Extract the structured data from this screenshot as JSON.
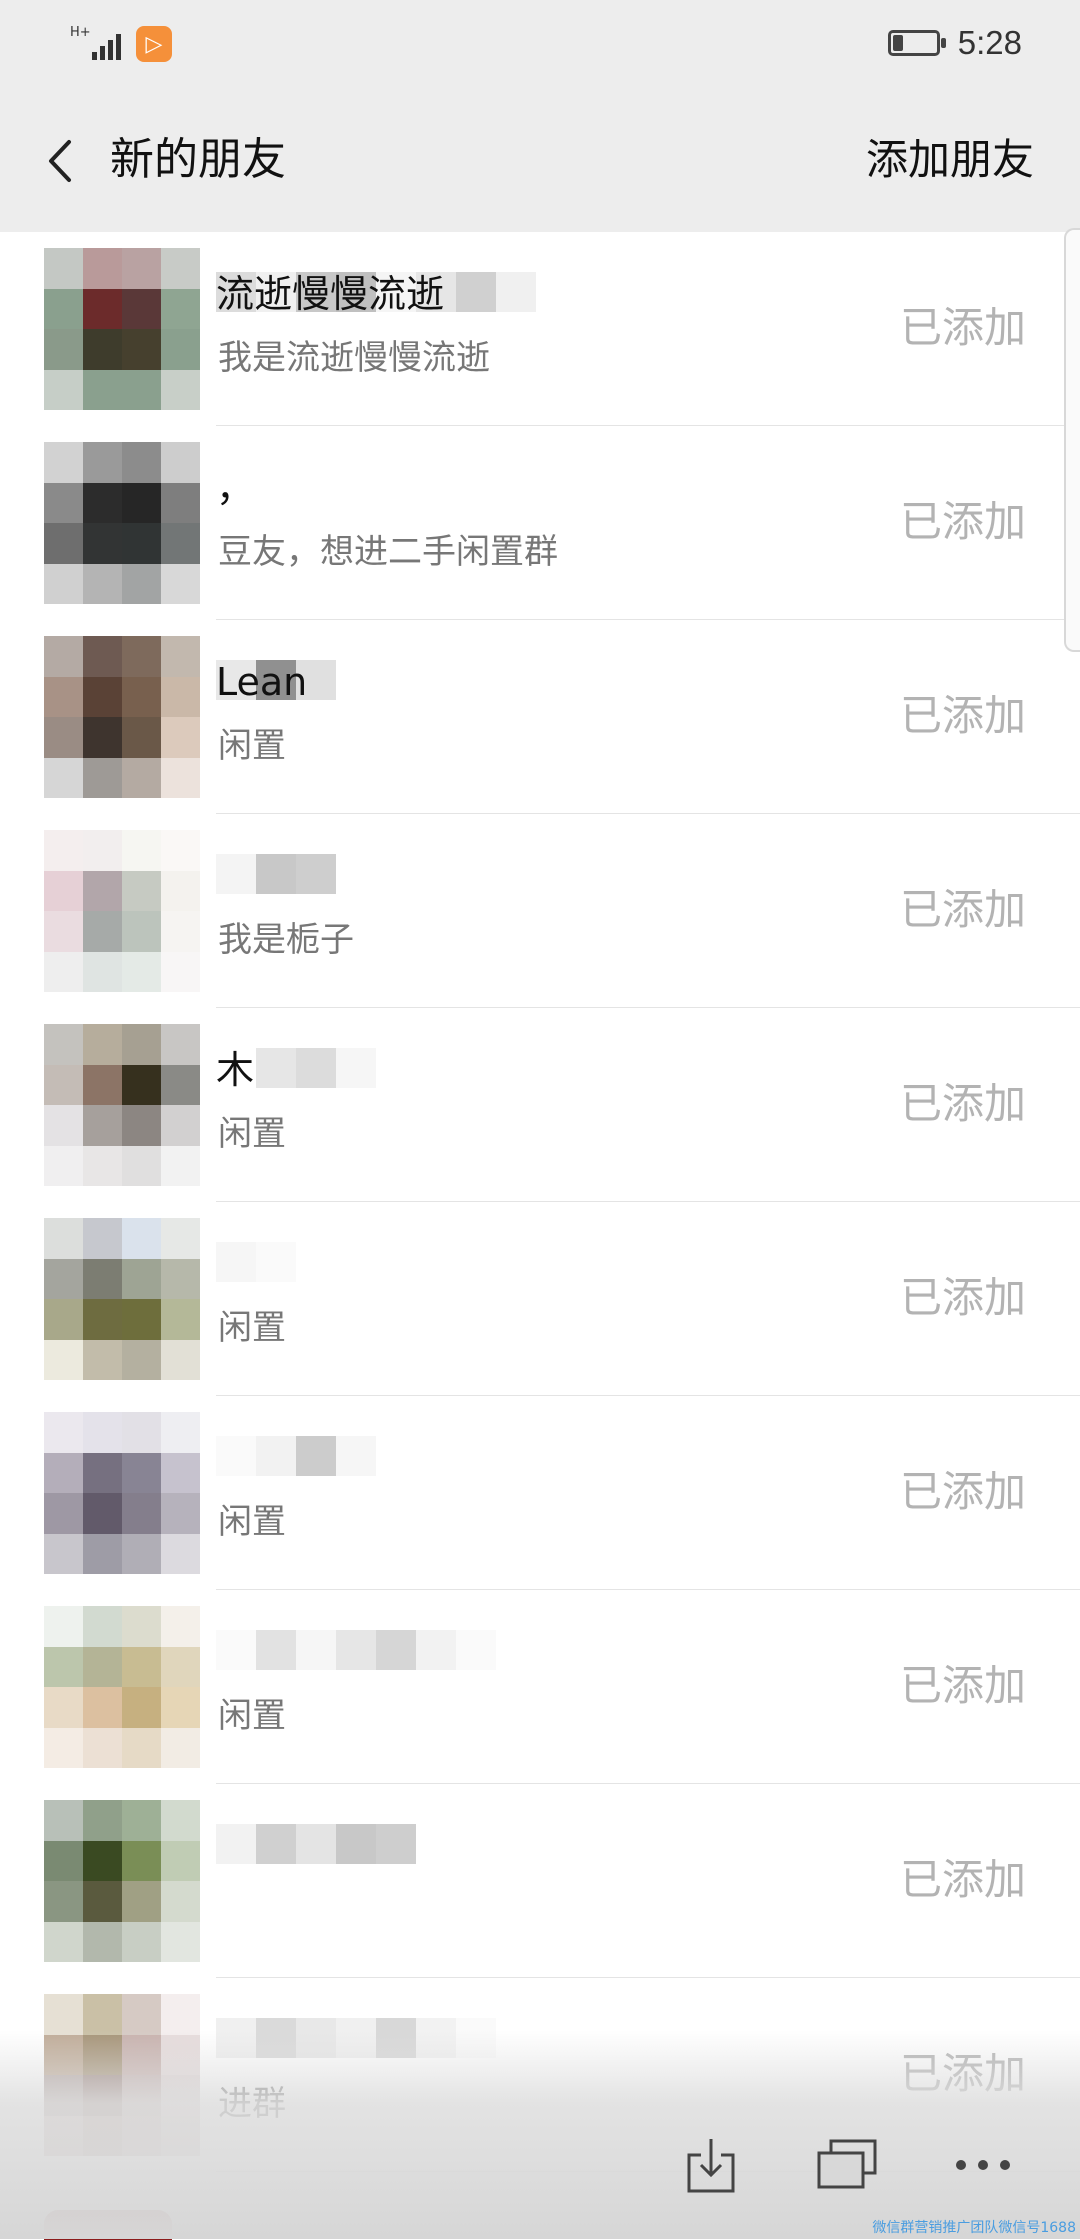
{
  "status_bar": {
    "network_label": "H+",
    "time": "5:28",
    "battery_level": 0.3
  },
  "nav": {
    "title": "新的朋友",
    "add_friend_label": "添加朋友"
  },
  "friends": [
    {
      "name": "流逝慢慢流逝",
      "message": "我是流逝慢慢流逝",
      "status": "已添加",
      "avatar_colors": [
        "#c4c8c4",
        "#b99a9a",
        "#b9a2a2",
        "#c8cbc7",
        "#8aa08e",
        "#6c2b2b",
        "#5a3838",
        "#8fa592",
        "#8a9a8a",
        "#3e3c2c",
        "#46402e",
        "#8aa08e",
        "#c6cec7",
        "#8aa08e",
        "#8aa08e",
        "#c8cfc8"
      ],
      "name_mosaic": [
        "#dcdcdc",
        "#f0f0f0",
        "#c8c8c8",
        "#c0c0c0",
        "#f5f5f5",
        "#e6e6e6",
        "#d0d0d0",
        "#f0f0f0"
      ]
    },
    {
      "name": "，",
      "message": "豆友，想进二手闲置群",
      "status": "已添加",
      "avatar_colors": [
        "#d2d2d2",
        "#9a9a9a",
        "#8c8c8c",
        "#cdcdcd",
        "#8a8a8a",
        "#2c2c2c",
        "#262626",
        "#7e7e7e",
        "#6e6e6e",
        "#323434",
        "#303434",
        "#727676",
        "#d0d0d0",
        "#b4b4b4",
        "#a2a4a4",
        "#d8d8d8"
      ],
      "name_mosaic": []
    },
    {
      "name": "Lean",
      "message": "闲置",
      "status": "已添加",
      "avatar_colors": [
        "#b4aaa4",
        "#6e5a52",
        "#7e6a5c",
        "#c2b8ae",
        "#a89286",
        "#5a4236",
        "#78604e",
        "#cab8a8",
        "#9a8c84",
        "#3e342e",
        "#6a5848",
        "#dccabc",
        "#d6d6d6",
        "#9e9a96",
        "#b4aaa2",
        "#ece2dc"
      ],
      "name_mosaic": [
        "#e8e8e8",
        "#909090",
        "#e0e0e0"
      ]
    },
    {
      "name": "",
      "message": "我是栀子",
      "status": "已添加",
      "avatar_colors": [
        "#f4eeee",
        "#f2eeee",
        "#f6f6f2",
        "#faf8f6",
        "#e6d0d6",
        "#b2a6aa",
        "#c6cac2",
        "#f4f2ee",
        "#eadce0",
        "#a6aaa8",
        "#bcc4bc",
        "#f6f4f2",
        "#eeeeee",
        "#dfe4e2",
        "#e4eae6",
        "#f8f6f6"
      ],
      "name_mosaic": [
        "#f4f4f4",
        "#c8c8c8",
        "#cecece"
      ]
    },
    {
      "name": "木",
      "message": "闲置",
      "status": "已添加",
      "avatar_colors": [
        "#c4c2be",
        "#b6ad9c",
        "#a6a092",
        "#c8c6c4",
        "#c4bcb6",
        "#8c7466",
        "#36301e",
        "#8a8a86",
        "#e4e2e4",
        "#a6a09c",
        "#8c8682",
        "#d2d0d0",
        "#f0eff0",
        "#e8e6e6",
        "#e0dfdf",
        "#f2f2f2"
      ],
      "name_mosaic": [
        "#ffffff",
        "#e6e6e6",
        "#dcdcdc",
        "#f6f6f6"
      ]
    },
    {
      "name": "",
      "message": "闲置",
      "status": "已添加",
      "avatar_colors": [
        "#dcdedc",
        "#c6c8ce",
        "#dae2ec",
        "#e6e8e6",
        "#a4a59e",
        "#7c7d72",
        "#9ea494",
        "#b6b8aa",
        "#a8a88a",
        "#6e6c40",
        "#6e6e3c",
        "#b4b898",
        "#eceade",
        "#c2bcaa",
        "#b4b0a0",
        "#e2e0d6"
      ],
      "name_mosaic": [
        "#f6f6f6",
        "#fafafa"
      ]
    },
    {
      "name": "",
      "message": "闲置",
      "status": "已添加",
      "avatar_colors": [
        "#ebe8ee",
        "#e4e2ea",
        "#e2e0e6",
        "#eeeef2",
        "#b4aeba",
        "#767080",
        "#888494",
        "#c6c2ce",
        "#9e98a4",
        "#625a6a",
        "#847e8c",
        "#b6b2bc",
        "#c8c6cc",
        "#9e9ca6",
        "#b0aeb6",
        "#dcdadf"
      ],
      "name_mosaic": [
        "#fafafa",
        "#f2f2f2",
        "#cccccc",
        "#f6f6f6"
      ]
    },
    {
      "name": "",
      "message": "闲置",
      "status": "已添加",
      "avatar_colors": [
        "#eef2ee",
        "#d2dad0",
        "#dcdcce",
        "#f4f0ea",
        "#bcc6ac",
        "#b4b496",
        "#c8bc92",
        "#e0d6bc",
        "#e8dac6",
        "#dcc0a0",
        "#c6b080",
        "#e6d6b6",
        "#f4ece4",
        "#ece0d4",
        "#e6dac6",
        "#f2ece4"
      ],
      "name_mosaic": [
        "#fafafa",
        "#e2e2e2",
        "#f6f6f6",
        "#e6e6e6",
        "#d6d6d6",
        "#f2f2f2",
        "#fafafa"
      ]
    },
    {
      "name": "",
      "message": "",
      "status": "已添加",
      "avatar_colors": [
        "#b8c0b8",
        "#90a08a",
        "#9eb096",
        "#d2dace",
        "#7a8a72",
        "#3a4a22",
        "#7a8e56",
        "#c0ccb4",
        "#8a9682",
        "#5a5a3e",
        "#a0a084",
        "#d4dace",
        "#d0d6cc",
        "#b2b8ac",
        "#c8cec4",
        "#e2e6e0"
      ],
      "name_mosaic": [
        "#f2f2f2",
        "#d0d0d0",
        "#e4e4e4",
        "#c8c8c8",
        "#cecece"
      ]
    },
    {
      "name": "",
      "message": "进群",
      "status": "已添加",
      "avatar_colors": [
        "#e6e0d4",
        "#cac0a6",
        "#d6cac4",
        "#f4eeee",
        "#c0ac98",
        "#a69478",
        "#c8b2ae",
        "#e6dcdc",
        "#b6a8a4",
        "#a08a84",
        "#c6b4b2",
        "#e0d6d6",
        "#d2c2c0",
        "#bea6a2",
        "#ccbcba",
        "#dcd2d0"
      ],
      "name_mosaic": [
        "#f0f0f0",
        "#dadada",
        "#e8e8e8",
        "#f0f0f0",
        "#d8d8d8",
        "#f2f2f2",
        "#fafafa"
      ]
    }
  ],
  "toolbar": {
    "download_label": "download",
    "windows_label": "windows",
    "more_label": "more",
    "watermark": "微信群营销推广团队微信号1688"
  }
}
